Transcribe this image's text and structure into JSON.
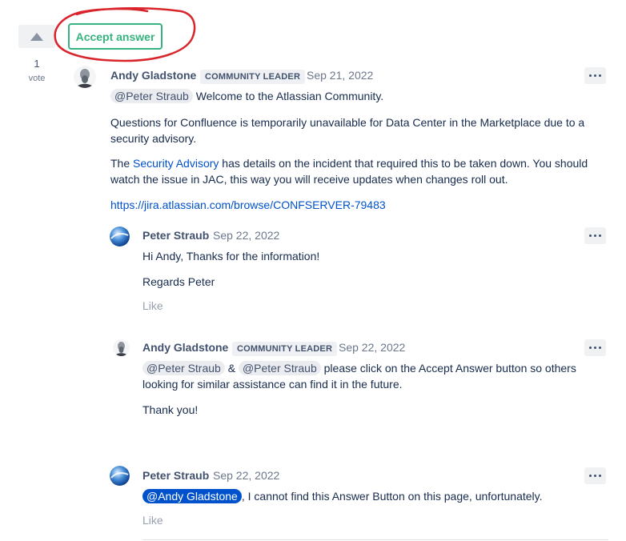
{
  "vote": {
    "count": "1",
    "label": "vote",
    "upvote_icon": "triangle-up-icon"
  },
  "accept": {
    "label": "Accept answer",
    "annotation_color": "#d9242b"
  },
  "answer": {
    "author": "Andy Gladstone",
    "badge": "COMMUNITY LEADER",
    "date": "Sep 21, 2022",
    "mention": "@Peter Straub",
    "greeting": "Welcome to the Atlassian Community.",
    "para1": "Questions for Confluence is temporarily unavailable for Data Center in the Marketplace due to a security advisory.",
    "para2_prefix": "The ",
    "para2_link": "Security Advisory",
    "para2_suffix": " has details on the incident that required this to be taken down. You should watch the issue in JAC, this way you will receive updates when changes roll out.",
    "url": "https://jira.atlassian.com/browse/CONFSERVER-79483"
  },
  "replies": [
    {
      "author": "Peter Straub",
      "date": "Sep 22, 2022",
      "line1": "Hi Andy, Thanks for the information!",
      "line2": "Regards Peter",
      "like": "Like"
    },
    {
      "author": "Andy Gladstone",
      "badge": "COMMUNITY LEADER",
      "date": "Sep 22, 2022",
      "mention1": "@Peter Straub",
      "amp": "&",
      "mention2": "@Peter Straub",
      "body": "please click on the Accept Answer button so others looking for similar assistance can find it in the future.",
      "thanks": "Thank you!"
    },
    {
      "author": "Peter Straub",
      "date": "Sep 22, 2022",
      "mention": "@Andy Gladstone",
      "body": ", I cannot find this Answer Button on this page, unfortunately.",
      "like": "Like"
    }
  ],
  "colors": {
    "accent_green": "#36b37e",
    "link_blue": "#0052cc",
    "text": "#172b4d",
    "muted": "#6b778c"
  }
}
